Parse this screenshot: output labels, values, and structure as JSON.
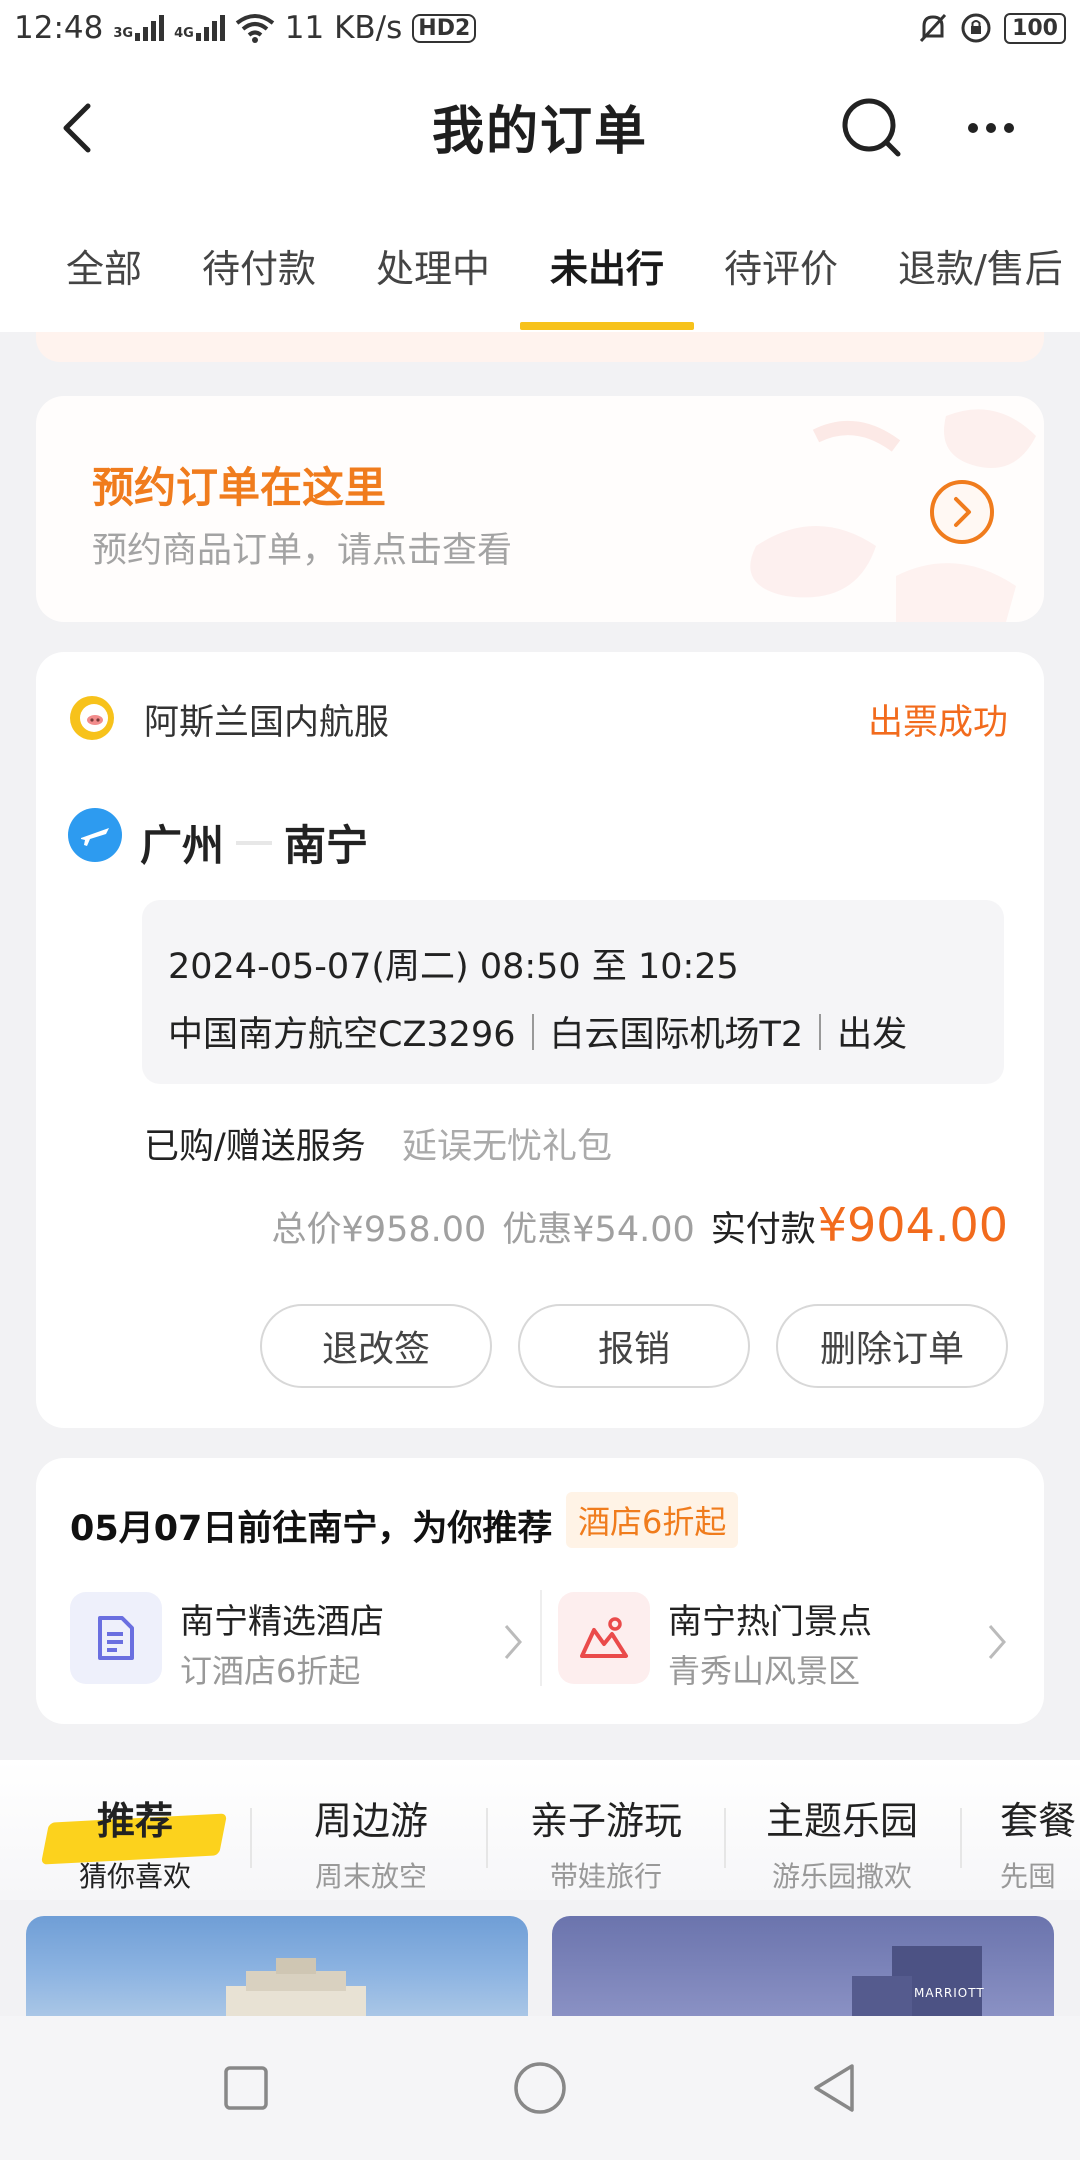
{
  "status_bar": {
    "time": "12:48",
    "net1": "3G",
    "net2": "4G",
    "speed": "11 KB/s",
    "hd": "HD2",
    "battery": "100"
  },
  "header": {
    "title": "我的订单"
  },
  "tabs": [
    "全部",
    "待付款",
    "处理中",
    "未出行",
    "待评价",
    "退款/售后"
  ],
  "active_tab": "未出行",
  "booking": {
    "title": "预约订单在这里",
    "subtitle": "预约商品订单，请点击查看"
  },
  "order": {
    "vendor": "阿斯兰国内航服",
    "status": "出票成功",
    "from": "广州",
    "to": "南宁",
    "time": "2024-05-07(周二) 08:50 至 10:25",
    "airline": "中国南方航空CZ3296",
    "airport": "白云国际机场T2",
    "action": "出发",
    "service_label": "已购/赠送服务",
    "service_value": "延误无忧礼包",
    "total": "总价¥958.00",
    "discount": "优惠¥54.00",
    "paid_label": "实付款",
    "paid": "¥904.00",
    "buttons": [
      "退改签",
      "报销",
      "删除订单"
    ]
  },
  "recommend": {
    "title": "05月07日前往南宁，为你推荐",
    "badge": "酒店6折起",
    "items": [
      {
        "name": "南宁精选酒店",
        "sub": "订酒店6折起",
        "icon": "hotel-doc-icon"
      },
      {
        "name": "南宁热门景点",
        "sub": "青秀山风景区",
        "icon": "mountain-scenic-icon"
      }
    ]
  },
  "categories": [
    {
      "main": "推荐",
      "sub": "猜你喜欢"
    },
    {
      "main": "周边游",
      "sub": "周末放空"
    },
    {
      "main": "亲子游玩",
      "sub": "带娃旅行"
    },
    {
      "main": "主题乐园",
      "sub": "游乐园撒欢"
    },
    {
      "main": "套餐",
      "sub": "先囤"
    }
  ],
  "photo_right_text": "MARRIOTT",
  "colors": {
    "accent": "#f7c21b",
    "orange": "#f26b1d",
    "plane_blue": "#2d9bf0"
  }
}
